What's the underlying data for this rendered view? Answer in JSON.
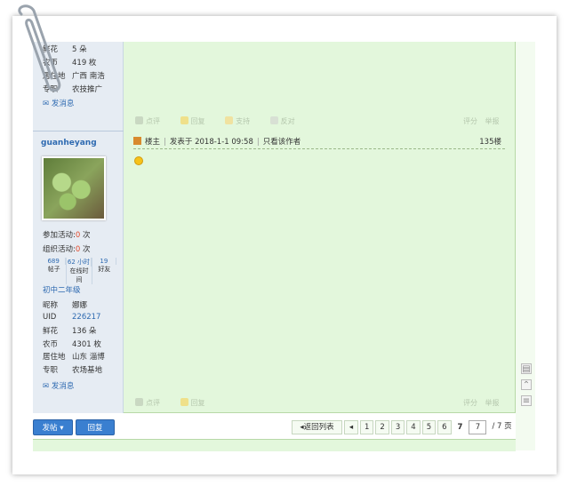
{
  "prev_user": {
    "rows": [
      {
        "label": "鲜花",
        "value": "5 朵"
      },
      {
        "label": "农币",
        "value": "419 枚"
      },
      {
        "label": "居住地",
        "value": "广西 南浩"
      },
      {
        "label": "专职",
        "value": "农技推广"
      }
    ],
    "send_msg": "发消息"
  },
  "prev_post_actions": {
    "rate": "点评",
    "reply": "回复",
    "support": "支持",
    "oppose": "反对",
    "score": "评分",
    "report": "举报"
  },
  "user": {
    "name": "guanheyang",
    "activity_join_label": "参加活动:",
    "activity_join_count": "0",
    "activity_join_unit": "次",
    "activity_org_label": "组织活动:",
    "activity_org_count": "0",
    "activity_org_unit": "次",
    "stats": [
      {
        "n": "689",
        "label": "帖子"
      },
      {
        "n": "62 小时",
        "label": "在线时间"
      },
      {
        "n": "19",
        "label": "好友"
      }
    ],
    "level": "初中二年级",
    "rows": [
      {
        "label": "昵称",
        "value": "娜娜"
      },
      {
        "label": "UID",
        "value": "226217"
      },
      {
        "label": "鲜花",
        "value": "136 朵"
      },
      {
        "label": "农币",
        "value": "4301 枚"
      },
      {
        "label": "居住地",
        "value": "山东 淄博"
      },
      {
        "label": "专职",
        "value": "农场基地"
      }
    ],
    "send_msg": "发消息"
  },
  "post": {
    "author_tag": "楼主",
    "posted": "发表于 2018-1-1 09:58",
    "only_author": "只看该作者",
    "floor": "135楼"
  },
  "post_actions": {
    "rate": "点评",
    "reply": "回复",
    "score": "评分",
    "report": "举报"
  },
  "buttons": {
    "post": "发帖",
    "reply": "回复"
  },
  "pager": {
    "back": "返回列表",
    "pages": [
      "1",
      "2",
      "3",
      "4",
      "5",
      "6",
      "7"
    ],
    "current": "7",
    "input": "7",
    "total": "/ 7 页"
  },
  "colors": {
    "accent": "#3a7fd0",
    "content_bg": "#e3f7dc",
    "sidebar_bg": "#e6ecf3"
  }
}
